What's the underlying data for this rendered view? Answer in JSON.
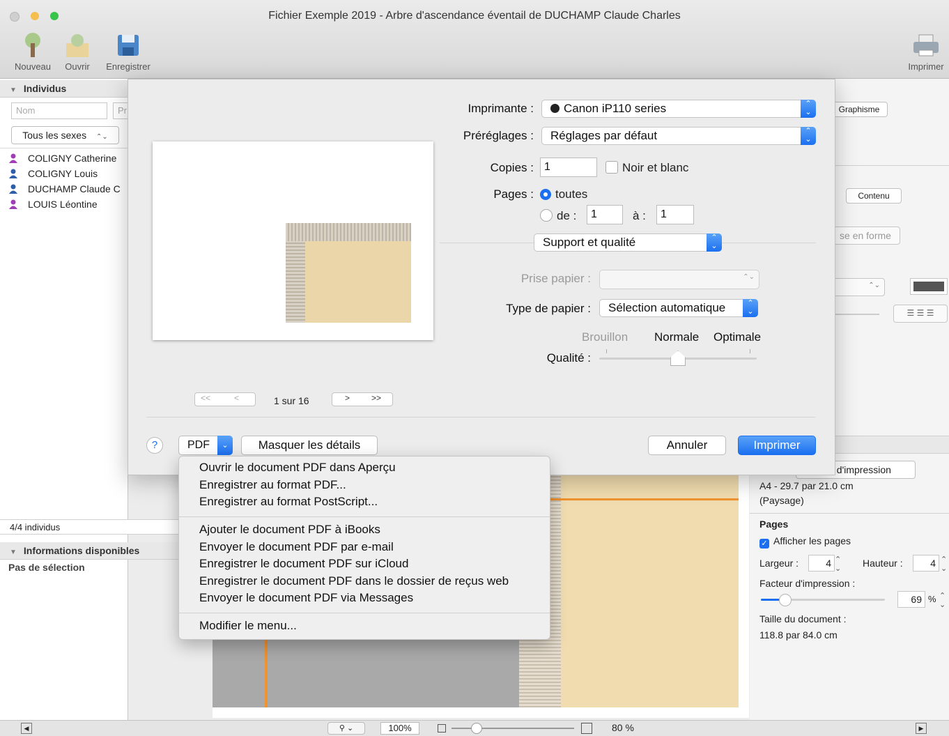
{
  "window": {
    "title": "Fichier Exemple 2019 - Arbre d'ascendance éventail de DUCHAMP Claude Charles"
  },
  "toolbar": {
    "new": "Nouveau",
    "open": "Ouvrir",
    "save": "Enregistrer",
    "print": "Imprimer"
  },
  "left": {
    "section_title": "Individus",
    "name_placeholder": "Nom",
    "firstname_placeholder": "Pr",
    "sex_filter": "Tous les sexes",
    "persons": [
      {
        "name": "COLIGNY Catherine",
        "sex": "female"
      },
      {
        "name": "COLIGNY Louis",
        "sex": "male"
      },
      {
        "name": "DUCHAMP Claude C",
        "sex": "male"
      },
      {
        "name": "LOUIS Léontine",
        "sex": "female"
      }
    ],
    "count": "4/4 individus",
    "info_title": "Informations disponibles",
    "no_selection": "Pas de sélection"
  },
  "right": {
    "tab_graphism": "Graphisme",
    "tab_partial": "e",
    "tab_content": "Contenu",
    "layout_btn": "se en forme",
    "print_setup_btn": "t d'impression",
    "paper_size": "A4 - 29.7 par 21.0 cm",
    "orientation": "(Paysage)",
    "pages_title": "Pages",
    "show_pages": "Afficher les pages",
    "width_label": "Largeur :",
    "width_value": "4",
    "height_label": "Hauteur :",
    "height_value": "4",
    "factor_label": "Facteur d'impression :",
    "factor_value": "69",
    "factor_unit": "%",
    "doc_size_label": "Taille du document :",
    "doc_size_value": "118.8 par 84.0 cm"
  },
  "dialog": {
    "printer_label": "Imprimante :",
    "printer_value": "Canon iP110 series",
    "presets_label": "Préréglages :",
    "presets_value": "Réglages par défaut",
    "copies_label": "Copies :",
    "copies_value": "1",
    "bw_label": "Noir et blanc",
    "pages_label": "Pages :",
    "pages_all": "toutes",
    "pages_from": "de :",
    "pages_from_value": "1",
    "pages_to": "à :",
    "pages_to_value": "1",
    "section_value": "Support et qualité",
    "paper_feed_label": "Prise papier :",
    "paper_type_label": "Type de papier :",
    "paper_type_value": "Sélection automatique",
    "quality_draft": "Brouillon",
    "quality_normal": "Normale",
    "quality_best": "Optimale",
    "quality_label": "Qualité :",
    "page_nav_first": "<<",
    "page_nav_prev": "<",
    "page_indicator": "1 sur 16",
    "page_nav_next": ">",
    "page_nav_last": ">>",
    "help": "?",
    "pdf_btn": "PDF",
    "hide_details": "Masquer les détails",
    "cancel": "Annuler",
    "print": "Imprimer"
  },
  "pdf_menu": [
    "Ouvrir le document PDF dans Aperçu",
    "Enregistrer au format PDF...",
    "Enregistrer au format PostScript...",
    "Ajouter le document PDF à iBooks",
    "Envoyer le document PDF par e-mail",
    "Enregistrer le document PDF sur iCloud",
    "Enregistrer le document PDF dans le dossier de reçus web",
    "Envoyer le document PDF via Messages",
    "Modifier le menu..."
  ],
  "bottom": {
    "zoom": "100%",
    "zoom2": "80 %"
  },
  "colors": {
    "accent": "#1b6ff0",
    "female_icon": "#a03fb5",
    "male_icon": "#2d5fa8",
    "orange_line": "#f0922e"
  }
}
